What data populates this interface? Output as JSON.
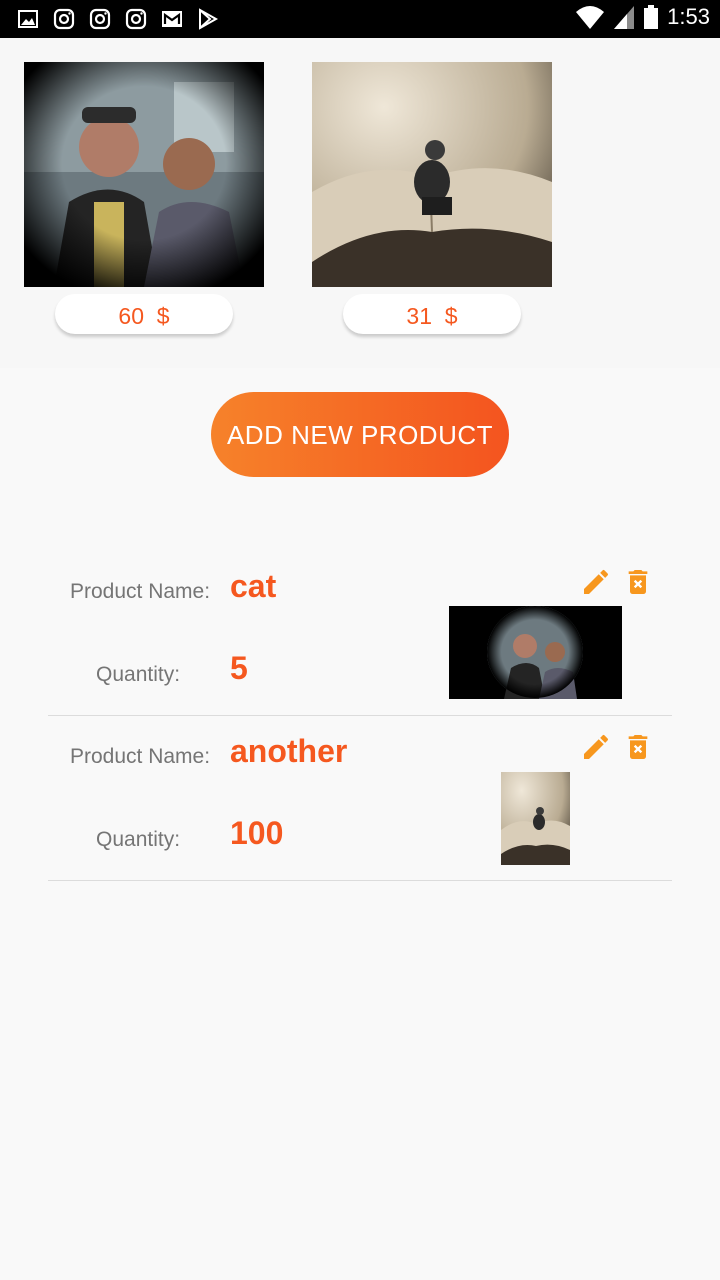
{
  "status_bar": {
    "time": "1:53",
    "left_icons": [
      "gallery-icon",
      "instagram-icon",
      "instagram-icon",
      "instagram-icon",
      "gmail-icon",
      "play-store-icon"
    ],
    "right_icons": [
      "wifi-icon",
      "signal-icon",
      "battery-icon"
    ]
  },
  "gallery": {
    "products": [
      {
        "price": "60",
        "currency": "$",
        "image": "photo-two-men"
      },
      {
        "price": "31",
        "currency": "$",
        "image": "photo-man-on-book"
      }
    ]
  },
  "actions": {
    "add_label": "ADD NEW PRODUCT"
  },
  "list": {
    "name_label": "Product Name:",
    "quantity_label": "Quantity:",
    "items": [
      {
        "name": "cat",
        "quantity": "5",
        "image": "photo-two-men"
      },
      {
        "name": "another",
        "quantity": "100",
        "image": "photo-man-on-book"
      }
    ]
  },
  "colors": {
    "accent": "#f5581f",
    "icon_orange": "#f7971e",
    "button_gradient_start": "#f6822a",
    "button_gradient_end": "#f4541f"
  }
}
